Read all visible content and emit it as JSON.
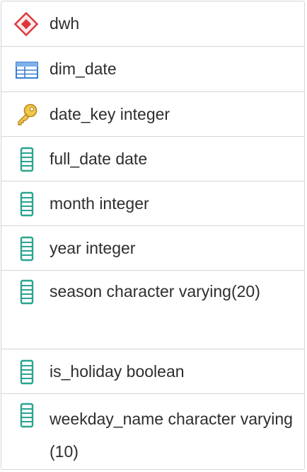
{
  "schema": {
    "label": "dwh",
    "icon": "schema-icon"
  },
  "table": {
    "label": "dim_date",
    "icon": "table-icon"
  },
  "columns": [
    {
      "label": "date_key integer",
      "icon": "primary-key-icon"
    },
    {
      "label": "full_date date",
      "icon": "column-icon"
    },
    {
      "label": "month integer",
      "icon": "column-icon"
    },
    {
      "label": "year integer",
      "icon": "column-icon"
    },
    {
      "label": "season character varying(20)",
      "icon": "column-icon"
    },
    {
      "label": "is_holiday boolean",
      "icon": "column-icon"
    },
    {
      "label": "weekday_name character varying(10)",
      "icon": "column-icon"
    }
  ],
  "colors": {
    "schema": "#d9373a",
    "table": "#3b7fd0",
    "key": "#e3b52a",
    "column": "#2aa48f",
    "border": "#d2d6dc"
  }
}
